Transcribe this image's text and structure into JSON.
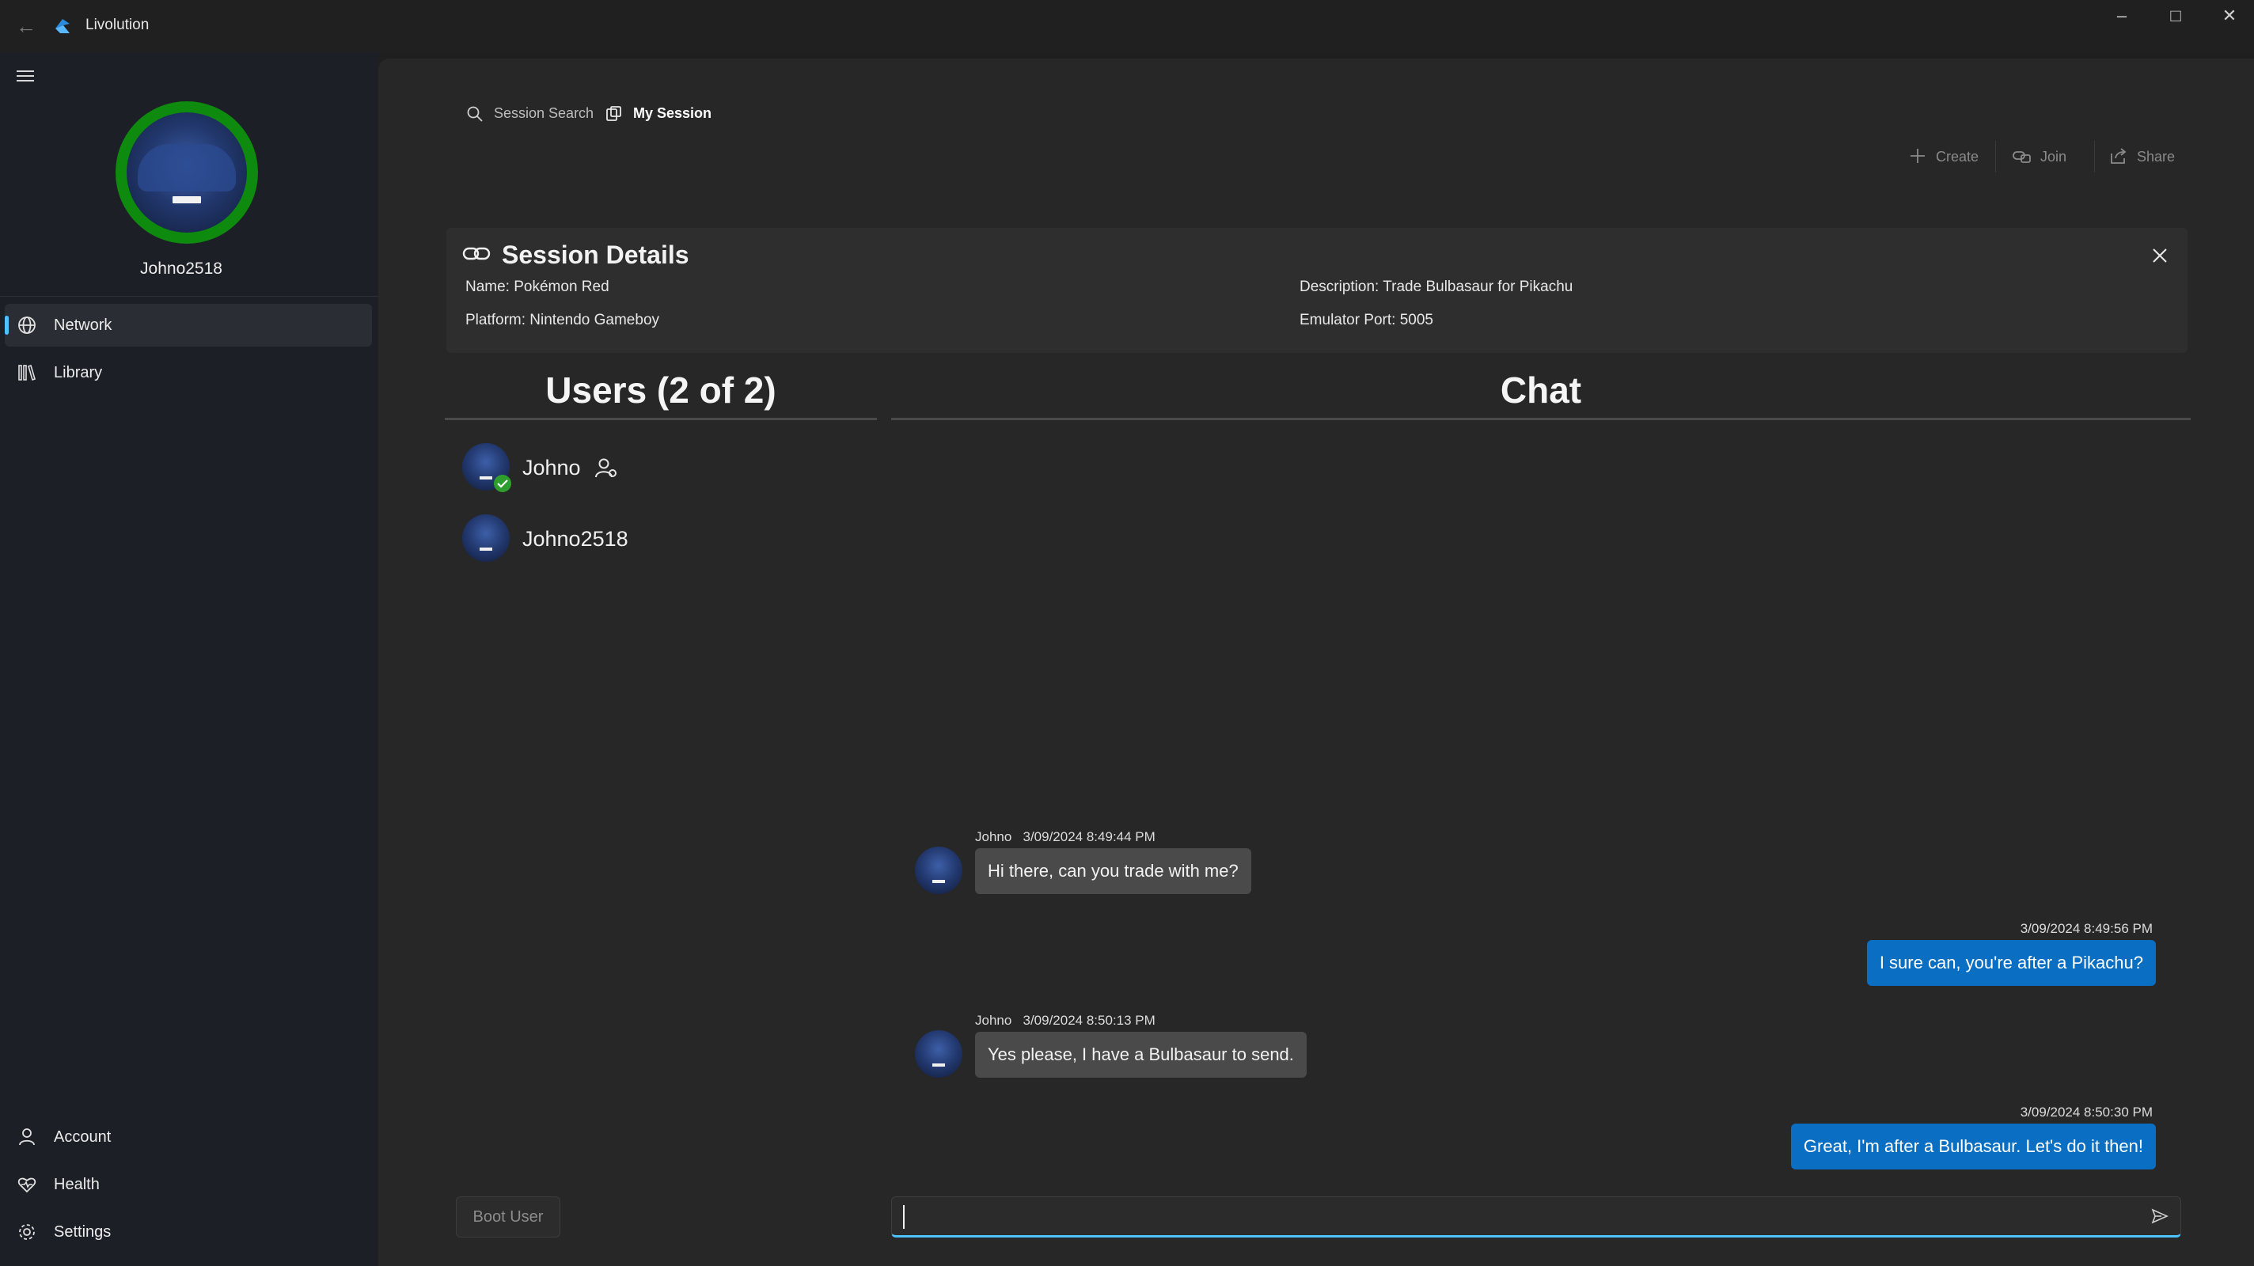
{
  "window": {
    "title": "Livolution"
  },
  "sidebar": {
    "username": "Johno2518",
    "items": [
      {
        "label": "Network",
        "icon": "globe-icon",
        "selected": true
      },
      {
        "label": "Library",
        "icon": "library-icon"
      }
    ],
    "footer_items": [
      {
        "label": "Account",
        "icon": "person-icon"
      },
      {
        "label": "Health",
        "icon": "heart-pulse-icon"
      },
      {
        "label": "Settings",
        "icon": "gear-icon"
      }
    ]
  },
  "topnav": {
    "items": [
      {
        "label": "Session Search",
        "icon": "search-icon"
      },
      {
        "label": "My Session",
        "icon": "session-icon",
        "selected": true
      }
    ]
  },
  "commandbar": {
    "create": "Create",
    "join": "Join",
    "share": "Share"
  },
  "session": {
    "title": "Session Details",
    "name": "Name: Pokémon Red",
    "platform": "Platform: Nintendo Gameboy",
    "description": "Description: Trade Bulbasaur for Pikachu",
    "port": "Emulator Port: 5005"
  },
  "users": {
    "title": "Users (2 of 2)",
    "list": [
      {
        "name": "Johno",
        "host": true,
        "verified": true
      },
      {
        "name": "Johno2518"
      }
    ]
  },
  "chat": {
    "title": "Chat",
    "messages": [
      {
        "sender": "Johno",
        "time": "3/09/2024 8:49:44 PM",
        "text": "Hi there, can you trade with me?",
        "outgoing": false
      },
      {
        "time": "3/09/2024 8:49:56 PM",
        "text": "I sure can, you're after a Pikachu?",
        "outgoing": true
      },
      {
        "sender": "Johno",
        "time": "3/09/2024 8:50:13 PM",
        "text": "Yes please, I have a Bulbasaur to send.",
        "outgoing": false
      },
      {
        "time": "3/09/2024 8:50:30 PM",
        "text": "Great, I'm after a Bulbasaur. Let's do it then!",
        "outgoing": true
      }
    ],
    "input_value": ""
  },
  "actions": {
    "boot_user": "Boot User"
  },
  "colors": {
    "accent": "#4cc2ff",
    "outgoing_bubble": "#0a6fc2",
    "avatar_ring": "#0e8a0e"
  }
}
